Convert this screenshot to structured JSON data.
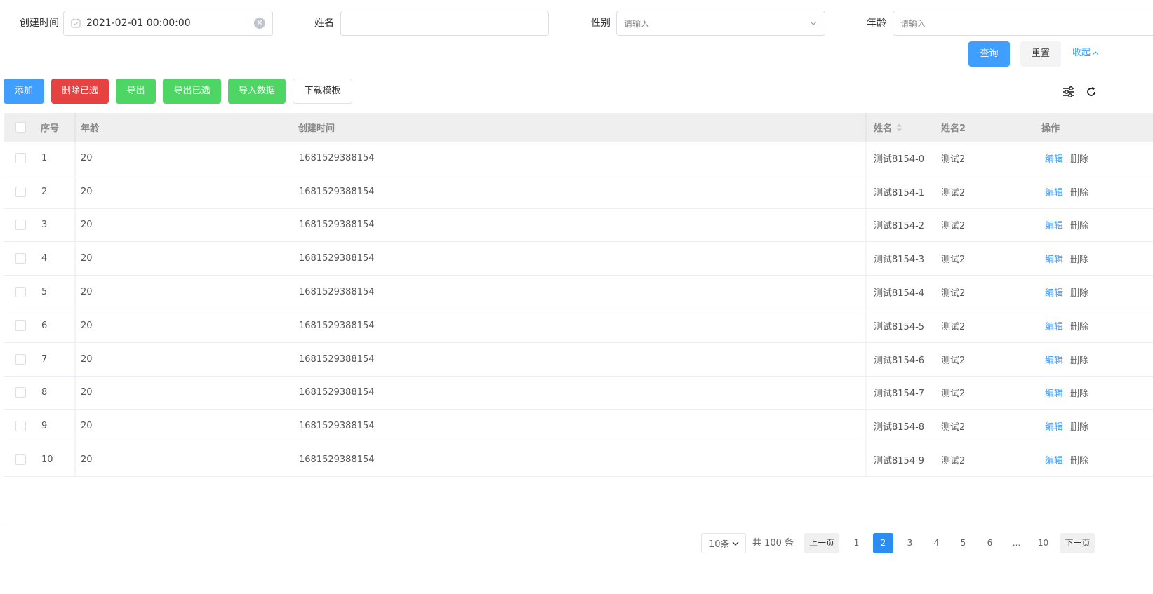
{
  "search": {
    "created_label": "创建时间",
    "created_value": "2021-02-01 00:00:00",
    "name_label": "姓名",
    "name_value": "",
    "gender_label": "性别",
    "gender_placeholder": "请输入",
    "age_label": "年龄",
    "age_placeholder": "请输入",
    "query_label": "查询",
    "reset_label": "重置",
    "collapse_label": "收起"
  },
  "toolbar": {
    "add": "添加",
    "delete_selected": "删除已选",
    "export": "导出",
    "export_selected": "导出已选",
    "import": "导入数据",
    "download_template": "下载模板",
    "icons": [
      "sliders-icon",
      "refresh-icon"
    ]
  },
  "table": {
    "headers": {
      "index": "序号",
      "age": "年龄",
      "created": "创建时间",
      "name": "姓名",
      "name2": "姓名2",
      "actions": "操作"
    },
    "rows": [
      {
        "index": "1",
        "age": "20",
        "created": "1681529388154",
        "name": "测试8154-0",
        "name2": "测试2"
      },
      {
        "index": "2",
        "age": "20",
        "created": "1681529388154",
        "name": "测试8154-1",
        "name2": "测试2"
      },
      {
        "index": "3",
        "age": "20",
        "created": "1681529388154",
        "name": "测试8154-2",
        "name2": "测试2"
      },
      {
        "index": "4",
        "age": "20",
        "created": "1681529388154",
        "name": "测试8154-3",
        "name2": "测试2"
      },
      {
        "index": "5",
        "age": "20",
        "created": "1681529388154",
        "name": "测试8154-4",
        "name2": "测试2"
      },
      {
        "index": "6",
        "age": "20",
        "created": "1681529388154",
        "name": "测试8154-5",
        "name2": "测试2"
      },
      {
        "index": "7",
        "age": "20",
        "created": "1681529388154",
        "name": "测试8154-6",
        "name2": "测试2"
      },
      {
        "index": "8",
        "age": "20",
        "created": "1681529388154",
        "name": "测试8154-7",
        "name2": "测试2"
      },
      {
        "index": "9",
        "age": "20",
        "created": "1681529388154",
        "name": "测试8154-8",
        "name2": "测试2"
      },
      {
        "index": "10",
        "age": "20",
        "created": "1681529388154",
        "name": "测试8154-9",
        "name2": "测试2"
      }
    ],
    "edit_label": "编辑",
    "delete_label": "删除"
  },
  "pagination": {
    "page_size": "10条",
    "total": "共 100 条",
    "prev": "上一页",
    "next": "下一页",
    "pages": [
      "1",
      "2",
      "3",
      "4",
      "5",
      "6",
      "...",
      "10"
    ],
    "current": "2"
  },
  "colors": {
    "primary": "#409eff",
    "danger": "#e64242",
    "success": "#4ed665",
    "active_page": "#2d8cf0"
  }
}
